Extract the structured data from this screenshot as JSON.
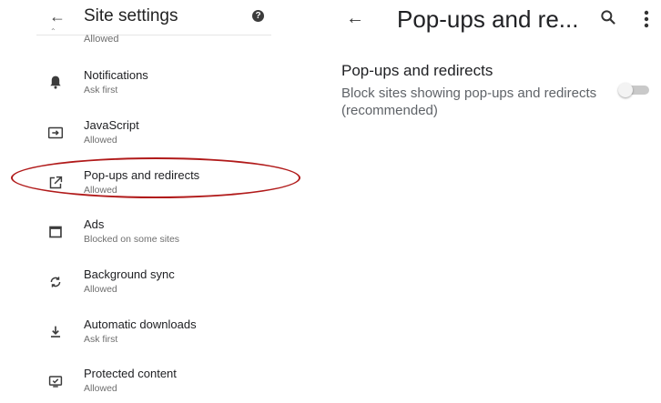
{
  "left": {
    "header": {
      "title": "Site settings",
      "help_glyph": "?"
    },
    "previous_item_status": "Allowed",
    "items": [
      {
        "title": "Notifications",
        "status": "Ask first",
        "icon": "bell-icon"
      },
      {
        "title": "JavaScript",
        "status": "Allowed",
        "icon": "javascript-icon"
      },
      {
        "title": "Pop-ups and redirects",
        "status": "Allowed",
        "icon": "open-in-new-icon"
      },
      {
        "title": "Ads",
        "status": "Blocked on some sites",
        "icon": "ads-icon"
      },
      {
        "title": "Background sync",
        "status": "Allowed",
        "icon": "sync-icon"
      },
      {
        "title": "Automatic downloads",
        "status": "Ask first",
        "icon": "download-icon"
      },
      {
        "title": "Protected content",
        "status": "Allowed",
        "icon": "protected-content-icon"
      }
    ]
  },
  "right": {
    "header": {
      "title": "Pop-ups and re..."
    },
    "setting": {
      "title": "Pop-ups and redirects",
      "description": "Block sites showing pop-ups and redirects (recommended)",
      "enabled": false
    }
  },
  "annotation_color": "#b11a1a"
}
